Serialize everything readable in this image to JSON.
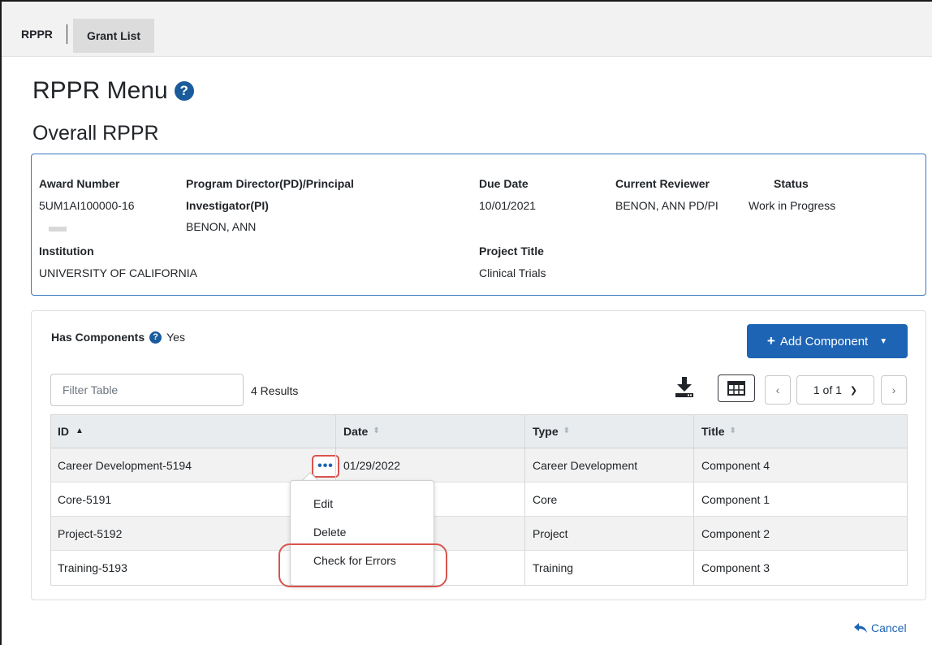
{
  "nav": {
    "app": "RPPR",
    "grant_list": "Grant List"
  },
  "page": {
    "title": "RPPR Menu",
    "subtitle": "Overall RPPR"
  },
  "award": {
    "award_number_label": "Award Number",
    "award_number": "5UM1AI100000-16",
    "pd_label_line1": "Program Director(PD)/Principal",
    "pd_label_line2": "Investigator(PI)",
    "pd_name": "BENON, ANN",
    "due_date_label": "Due Date",
    "due_date": "10/01/2021",
    "reviewer_label": "Current Reviewer",
    "reviewer": "BENON, ANN PD/PI",
    "status_label": "Status",
    "status": "Work in Progress",
    "institution_label": "Institution",
    "institution": "UNIVERSITY OF CALIFORNIA",
    "project_title_label": "Project Title",
    "project_title": "Clinical Trials"
  },
  "components": {
    "has_components_label": "Has Components",
    "has_components_value": "Yes",
    "add_button": "Add Component",
    "filter_placeholder": "Filter Table",
    "results": "4 Results",
    "page_indicator": "1 of 1",
    "columns": [
      "ID",
      "Date",
      "Type",
      "Title"
    ],
    "rows": [
      {
        "id": "Career Development-5194",
        "date": "01/29/2022",
        "type": "Career Development",
        "title": "Component 4"
      },
      {
        "id": "Core-5191",
        "date": "",
        "type": "Core",
        "title": "Component 1"
      },
      {
        "id": "Project-5192",
        "date": "",
        "type": "Project",
        "title": "Component 2"
      },
      {
        "id": "Training-5193",
        "date": "",
        "type": "Training",
        "title": "Component 3"
      }
    ],
    "actions_menu": {
      "button": "•••",
      "items": [
        "Edit",
        "Delete",
        "Check for Errors"
      ]
    }
  },
  "footer": {
    "cancel": "Cancel"
  },
  "colors": {
    "primary": "#1e64b4",
    "highlight": "#d9534f",
    "card_border": "#3b78c0"
  }
}
